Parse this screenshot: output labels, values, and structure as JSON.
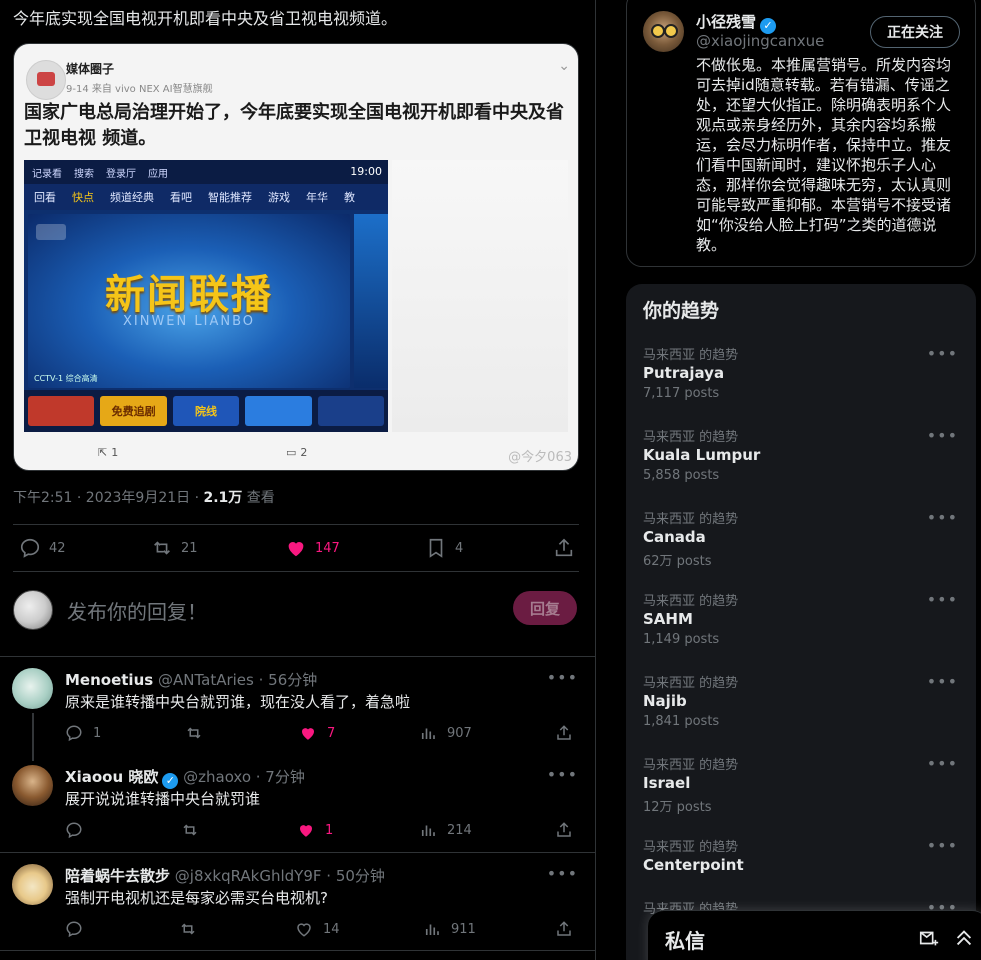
{
  "tweet": {
    "text": "今年底实现全国电视开机即看中央及省卫视电视频道。",
    "media": {
      "source_name": "媒体圈子",
      "source_meta": "9-14 来自 vivo NEX AI智慧旗舰",
      "headline": "国家广电总局治理开始了，今年底要实现全国电视开机即看中央及省卫视电视 频道。",
      "tv_top_items": [
        "记录看",
        "搜索",
        "登录厅",
        "应用"
      ],
      "tv_time": "19:00",
      "tv_nav": [
        "回看",
        "快点",
        "频道经典",
        "看吧",
        "智能推荐",
        "游戏",
        "年华",
        "教"
      ],
      "tv_title": "新闻联播",
      "tv_subtitle": "XINWEN LIANBO",
      "tv_caption": "CCTV-1 综合高清",
      "tv_tiles": [
        "免费追剧",
        "院线"
      ],
      "repost_count": "1",
      "comment_count": "2",
      "watermark": "@今夕063"
    },
    "timestamp": "下午2:51 · 2023年9月21日 · ",
    "views": "2.1万",
    "views_label": " 查看",
    "stats": {
      "replies": "42",
      "retweets": "21",
      "likes": "147",
      "bookmarks": "4"
    }
  },
  "reply_box": {
    "placeholder": "发布你的回复！",
    "button": "回复"
  },
  "replies": [
    {
      "name": "Menoetius",
      "handle": "@ANTatAries · 56分钟",
      "text": "原来是谁转播中央台就罚谁，现在没人看了，着急啦",
      "replies": "1",
      "retweets": "",
      "likes": "7",
      "views": "907",
      "liked": true,
      "verified": false
    },
    {
      "name": "Xiaoou 晓欧",
      "handle": "@zhaoxo · 7分钟",
      "text": "展开说说谁转播中央台就罚谁",
      "replies": "",
      "retweets": "",
      "likes": "1",
      "views": "214",
      "liked": true,
      "verified": true
    },
    {
      "name": "陪着蜗牛去散步",
      "handle": "@j8xkqRAkGhldY9F · 50分钟",
      "text": "强制开电视机还是每家必需买台电视机?",
      "replies": "",
      "retweets": "",
      "likes": "14",
      "views": "911",
      "liked": false,
      "verified": false
    }
  ],
  "profile": {
    "name": "小径残雪",
    "handle": "@xiaojingcanxue",
    "follow_button": "正在关注",
    "bio": "不做伥鬼。本推属营销号。所发内容均可去掉id随意转载。若有错漏、传谣之处，还望大伙指正。除明确表明系个人观点或亲身经历外，其余内容均系搬运，会尽力标明作者，保持中立。推友们看中国新闻时，建议怀抱乐子人心态，那样你会觉得趣味无穷，太认真则可能导致严重抑郁。本营销号不接受诸如“你没给人脸上打码”之类的道德说教。"
  },
  "trends": {
    "title": "你的趋势",
    "items": [
      {
        "context": "马来西亚 的趋势",
        "name": "Putrajaya",
        "count": "7,117 posts"
      },
      {
        "context": "马来西亚 的趋势",
        "name": "Kuala Lumpur",
        "count": "5,858 posts"
      },
      {
        "context": "马来西亚 的趋势",
        "name": "Canada",
        "count": "62万 posts"
      },
      {
        "context": "马来西亚 的趋势",
        "name": "SAHM",
        "count": "1,149 posts"
      },
      {
        "context": "马来西亚 的趋势",
        "name": "Najib",
        "count": "1,841 posts"
      },
      {
        "context": "马来西亚 的趋势",
        "name": "Israel",
        "count": "12万 posts"
      },
      {
        "context": "马来西亚 的趋势",
        "name": "Centerpoint",
        "count": ""
      },
      {
        "context": "马来西亚 的趋势",
        "name": "",
        "count": ""
      }
    ]
  },
  "dm": {
    "title": "私信"
  },
  "icons": {
    "reply": "reply-icon",
    "retweet": "retweet-icon",
    "like": "heart-icon",
    "bookmark": "bookmark-icon",
    "share": "share-icon",
    "views": "views-bar-icon",
    "more": "more-dots-icon",
    "verified": "verified-badge-icon",
    "new_message": "new-message-icon",
    "collapse": "chevron-up-icon"
  },
  "colors": {
    "like_active": "#f91880",
    "verified": "#1d9bf0",
    "reply_button_bg": "#6b1c42",
    "text_secondary": "#71767b"
  }
}
